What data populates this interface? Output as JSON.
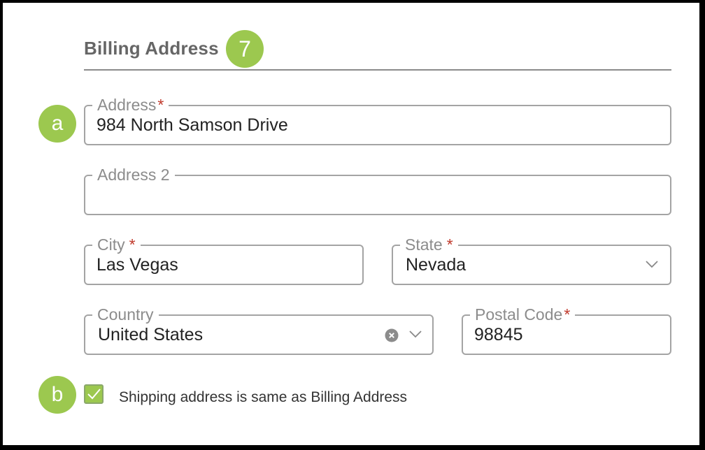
{
  "section": {
    "title": "Billing Address",
    "step_badge": "7"
  },
  "annotations": {
    "a": "a",
    "b": "b"
  },
  "fields": {
    "address": {
      "label": "Address",
      "required_mark": "*",
      "value": "984 North Samson Drive"
    },
    "address2": {
      "label": "Address 2",
      "value": ""
    },
    "city": {
      "label": "City",
      "required_mark": "*",
      "value": "Las Vegas"
    },
    "state": {
      "label": "State",
      "required_mark": "*",
      "value": "Nevada"
    },
    "country": {
      "label": "Country",
      "value": "United States"
    },
    "postal_code": {
      "label": "Postal Code",
      "required_mark": "*",
      "value": "98845"
    }
  },
  "shipping_same": {
    "label": "Shipping address is same as Billing Address",
    "checked": true
  },
  "colors": {
    "accent_green": "#9cc84f",
    "required_red": "#c0392b",
    "border_gray": "#a4a4a4",
    "label_gray": "#8c8c8c"
  },
  "icons": {
    "state_dropdown": "chevron-down-icon",
    "country_dropdown": "chevron-down-icon",
    "country_clear": "clear-icon",
    "checkbox_mark": "checkmark-icon"
  }
}
